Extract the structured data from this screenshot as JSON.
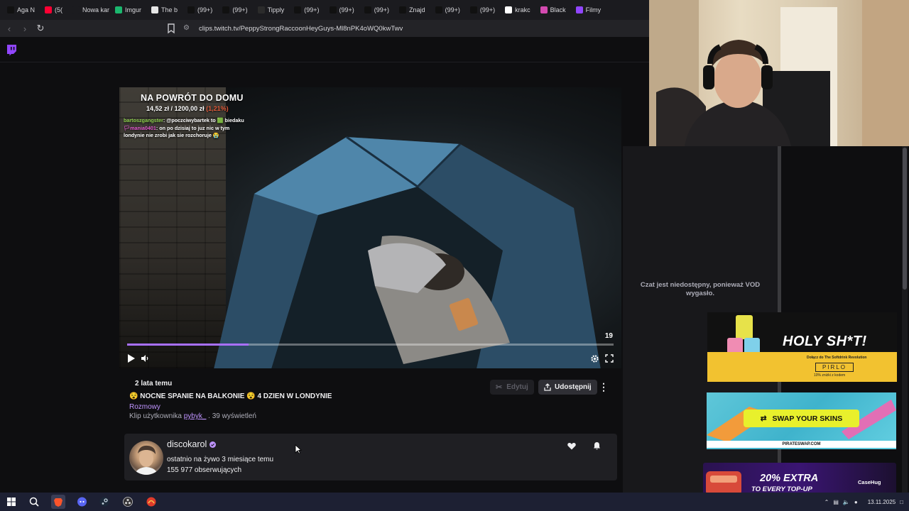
{
  "browser": {
    "tabs": [
      {
        "label": "Aga N",
        "icon": "tiktok-icon",
        "color": "#111111"
      },
      {
        "label": "(5(",
        "icon": "youtube-icon",
        "color": "#ff0033"
      },
      {
        "label": "Nowa kart",
        "icon": "blank-icon",
        "color": "#1b1b1f"
      },
      {
        "label": "Imgur",
        "icon": "imgur-icon",
        "color": "#1bb76e"
      },
      {
        "label": "The b",
        "icon": "diamond-icon",
        "color": "#e6e6e6"
      },
      {
        "label": "(99+)",
        "icon": "tiktok-icon",
        "color": "#111111"
      },
      {
        "label": "(99+)",
        "icon": "tiktok-icon",
        "color": "#111111"
      },
      {
        "label": "Tipply",
        "icon": "tipply-icon",
        "color": "#2b2b2b"
      },
      {
        "label": "(99+)",
        "icon": "tiktok-icon",
        "color": "#111111"
      },
      {
        "label": "(99+)",
        "icon": "tiktok-icon",
        "color": "#111111"
      },
      {
        "label": "(99+)",
        "icon": "tiktok-icon",
        "color": "#111111"
      },
      {
        "label": "Znajd",
        "icon": "tiktok-icon",
        "color": "#111111"
      },
      {
        "label": "(99+)",
        "icon": "tiktok-icon",
        "color": "#111111"
      },
      {
        "label": "(99+)",
        "icon": "tiktok-icon",
        "color": "#111111"
      },
      {
        "label": "krakc",
        "icon": "google-icon",
        "color": "#ffffff"
      },
      {
        "label": "Black",
        "icon": "pink-icon",
        "color": "#d44ab0"
      },
      {
        "label": "Filmy",
        "icon": "twitch-icon",
        "color": "#9146ff"
      }
    ],
    "url": "clips.twitch.tv/PeppyStrongRaccoonHeyGuys-Ml8nPK4oWQ0kwTwv"
  },
  "video": {
    "overlay_title": "NA POWRÓT DO DOMU",
    "money_current": "14,52 zł",
    "money_sep": "/",
    "money_goal": "1200,00 zł",
    "money_pct": "(1,21%)",
    "chat": [
      {
        "user": "bartoszgangster",
        "text": ": @poczciwybartek to 🟩 biedaku"
      },
      {
        "user": "🏳mania0401",
        "text": ": on po dzisiaj to juz nic w tym londynie nie zrobi jak sie rozchoruje 😭"
      }
    ],
    "time_remaining": "19",
    "progress": 0.25
  },
  "clip": {
    "when": "2 lata temu",
    "title": "😵 NOCNE SPANIE NA BALKONIE 😵 4 DZIEN W LONDYNIE",
    "category": "Rozmowy",
    "byline_prefix": "Klip użytkownika",
    "author": "pybyk_",
    "views": ". 39 wyświetleń",
    "edit_label": "Edytuj",
    "share_label": "Udostępnij"
  },
  "channel": {
    "name": "discokarol",
    "last_live": "ostatnio na żywo 3 miesiące temu",
    "followers": "155 977 obserwujących"
  },
  "chat_panel": {
    "unavailable": "Czat jest niedostępny, ponieważ VOD wygasło."
  },
  "ads": {
    "holy_text": "HOLY SH*T!",
    "holy_sub": "Dołącz do The Softdrink Revolution",
    "holy_code": "PIRLO",
    "holy_off": "10% zniżki z kodem",
    "swap_text": "SWAP YOUR SKINS",
    "swap_domain": "PIRATESWAP.COM",
    "casehug_big": "20% EXTRA",
    "casehug_small": "TO EVERY TOP-UP",
    "casehug_brand": "CaseHug"
  },
  "taskbar": {
    "date": "13.11.2025"
  },
  "colors": {
    "accent": "#9146ff",
    "link": "#bf94ff",
    "background": "#0e0e10"
  }
}
